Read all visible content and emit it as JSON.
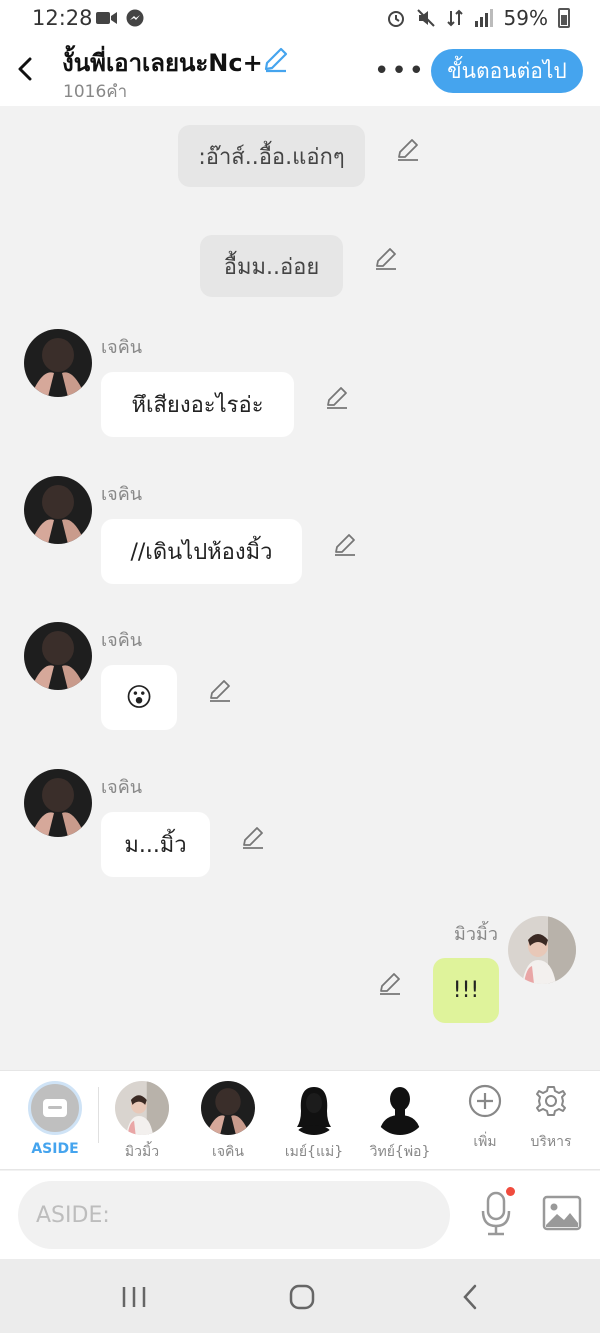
{
  "status_bar": {
    "time": "12:28",
    "battery_percent": "59%"
  },
  "header": {
    "title": "งั้นพี่เอาเลยนะNc+",
    "word_count": "1016คำ",
    "more_label": "•••",
    "next_button": "ขั้นตอนต่อไป"
  },
  "messages": [
    {
      "type": "narration",
      "text": ":อ๊าส์..อื้อ.แอ่กๆ"
    },
    {
      "type": "narration",
      "text": "อื้มม..อ่อย"
    },
    {
      "type": "character",
      "speaker": "เจคิน",
      "text": "หึเสียงอะไรอ่ะ"
    },
    {
      "type": "character",
      "speaker": "เจคิน",
      "text": "//เดินไปห้องมิ้ว"
    },
    {
      "type": "character",
      "speaker": "เจคิน",
      "text": "😮"
    },
    {
      "type": "character",
      "speaker": "เจคิน",
      "text": "ม...มิ้ว"
    },
    {
      "type": "own",
      "speaker": "มิวมิ้ว",
      "text": "!!!"
    }
  ],
  "character_bar": {
    "aside_label": "ASIDE",
    "characters": [
      {
        "name": "มิวมิ้ว"
      },
      {
        "name": "เจคิน"
      },
      {
        "name": "เมย์{แม่}"
      },
      {
        "name": "วิทย์{พ่อ}"
      }
    ],
    "add_label": "เพิ่ม",
    "manage_label": "บริหาร"
  },
  "input": {
    "placeholder": "ASIDE:"
  },
  "colors": {
    "accent": "#45a4ee",
    "own_bubble": "#dff39b",
    "narration_bubble": "#e6e6e6",
    "mic_dot": "#f04c3e"
  },
  "icons": [
    "back-arrow-icon",
    "pencil-icon",
    "more-icon",
    "chat-bubble-icon",
    "add-circle-icon",
    "gear-icon",
    "microphone-icon",
    "image-icon",
    "recent-apps-icon",
    "home-icon",
    "nav-back-icon"
  ]
}
